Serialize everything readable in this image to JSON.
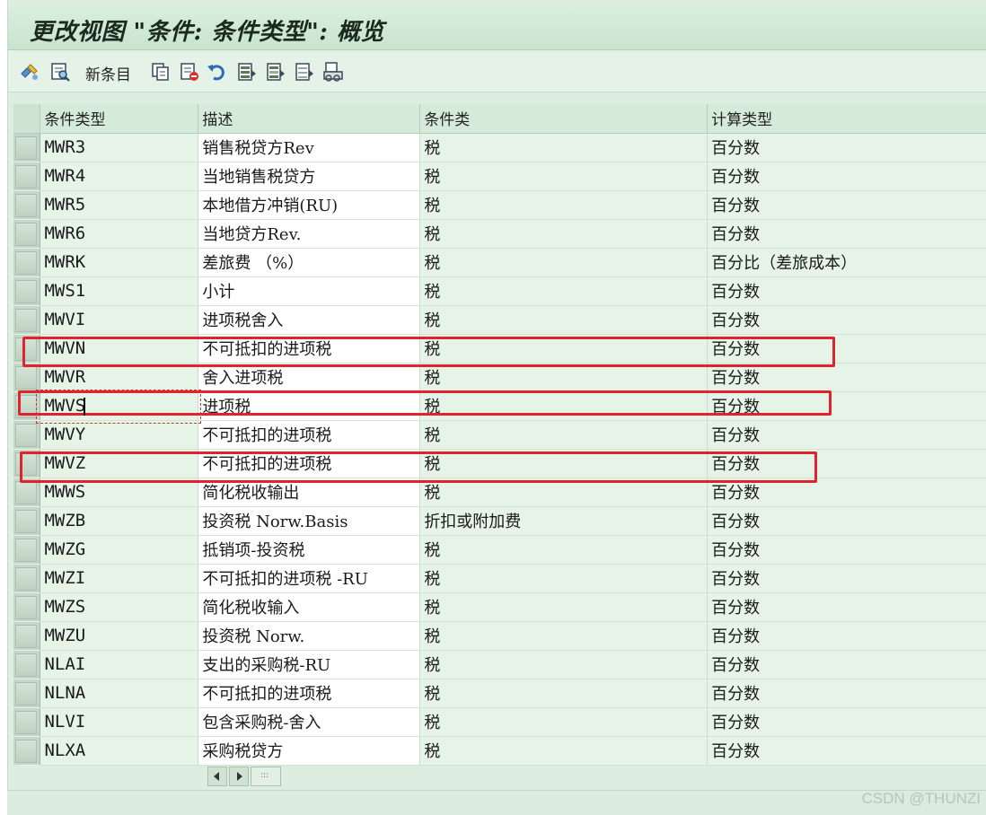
{
  "title": "更改视图 \"条件: 条件类型\": 概览",
  "toolbar": {
    "new_entries_label": "新条目",
    "icons": [
      "display-change-icon",
      "details-icon",
      "copy-icon",
      "delete-icon",
      "undo-icon",
      "select-all-icon",
      "select-block-icon",
      "deselect-all-icon",
      "print-icon"
    ]
  },
  "table": {
    "columns": [
      "条件类型",
      "描述",
      "条件类",
      "计算类型"
    ],
    "rows": [
      [
        "MWR3",
        "销售税贷方Rev",
        "税",
        "百分数"
      ],
      [
        "MWR4",
        "当地销售税贷方",
        "税",
        "百分数"
      ],
      [
        "MWR5",
        "本地借方冲销(RU)",
        "税",
        "百分数"
      ],
      [
        "MWR6",
        "当地贷方Rev.",
        "税",
        "百分数"
      ],
      [
        "MWRK",
        "差旅费 （%）",
        "税",
        "百分比（差旅成本）"
      ],
      [
        "MWS1",
        "小计",
        "税",
        "百分数"
      ],
      [
        "MWVI",
        "进项税舍入",
        "税",
        "百分数"
      ],
      [
        "MWVN",
        "不可抵扣的进项税",
        "税",
        "百分数"
      ],
      [
        "MWVR",
        "舍入进项税",
        "税",
        "百分数"
      ],
      [
        "MWVS",
        "进项税",
        "税",
        "百分数"
      ],
      [
        "MWVY",
        "不可抵扣的进项税",
        "税",
        "百分数"
      ],
      [
        "MWVZ",
        "不可抵扣的进项税",
        "税",
        "百分数"
      ],
      [
        "MWWS",
        "简化税收输出",
        "税",
        "百分数"
      ],
      [
        "MWZB",
        "投资税 Norw.Basis",
        "折扣或附加费",
        "百分数"
      ],
      [
        "MWZG",
        "抵销项-投资税",
        "税",
        "百分数"
      ],
      [
        "MWZI",
        "不可抵扣的进项税 -RU",
        "税",
        "百分数"
      ],
      [
        "MWZS",
        "简化税收输入",
        "税",
        "百分数"
      ],
      [
        "MWZU",
        "投资税 Norw.",
        "税",
        "百分数"
      ],
      [
        "NLAI",
        "支出的采购税-RU",
        "税",
        "百分数"
      ],
      [
        "NLNA",
        "不可抵扣的进项税",
        "税",
        "百分数"
      ],
      [
        "NLVI",
        "包含采购税-舍入",
        "税",
        "百分数"
      ],
      [
        "NLXA",
        "采购税贷方",
        "税",
        "百分数"
      ]
    ]
  },
  "watermark": "CSDN @THUNZI",
  "colors": {
    "highlight": "#e0242f",
    "window_bg": "#ddeee0"
  }
}
